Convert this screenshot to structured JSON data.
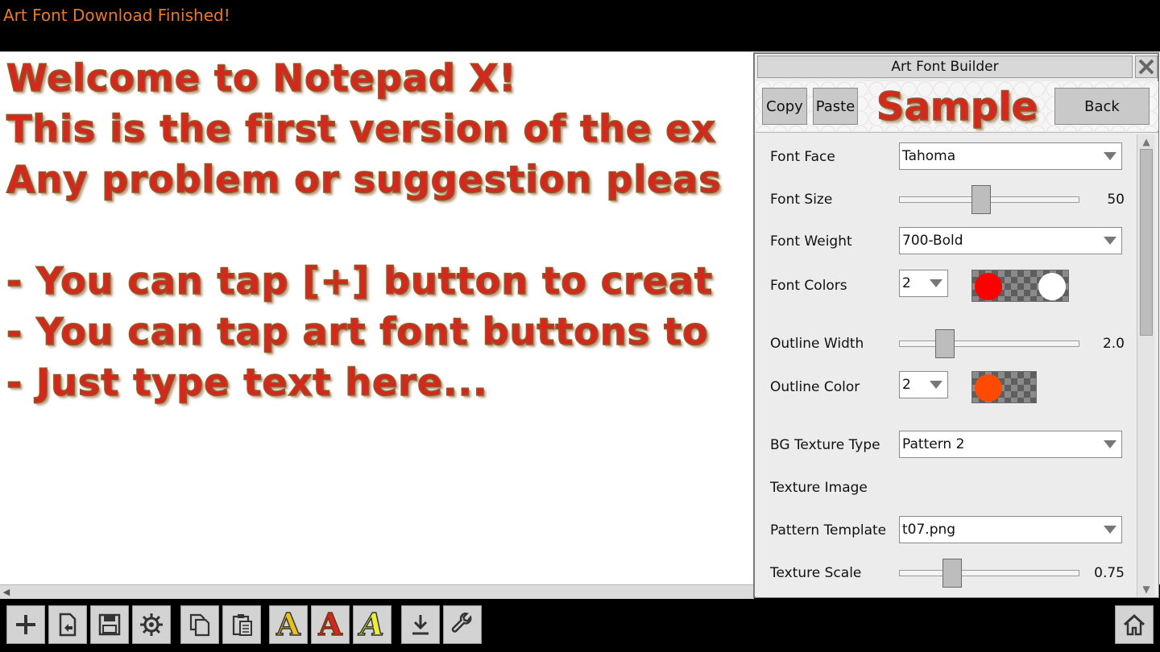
{
  "status": {
    "message": "Art Font Download Finished!"
  },
  "editor": {
    "lines": [
      "Welcome to Notepad X!",
      "This is the first version of the ex",
      "Any problem or suggestion pleas",
      "",
      "- You can tap [+] button to creat",
      "- You can tap art font buttons to",
      "- Just type text here..."
    ]
  },
  "panel": {
    "title": "Art Font Builder",
    "copy_label": "Copy",
    "paste_label": "Paste",
    "sample_label": "Sample",
    "back_label": "Back",
    "font_face": {
      "label": "Font Face",
      "value": "Tahoma"
    },
    "font_size": {
      "label": "Font Size",
      "value": "50",
      "fraction": 0.45
    },
    "font_weight": {
      "label": "Font Weight",
      "value": "700-Bold"
    },
    "font_colors": {
      "label": "Font Colors",
      "count": "2",
      "colors": [
        "#ff0000",
        "#ffffff"
      ]
    },
    "outline_width": {
      "label": "Outline Width",
      "value": "2.0",
      "fraction": 0.22
    },
    "outline_color": {
      "label": "Outline Color",
      "count": "2",
      "colors": [
        "#ff4a00"
      ]
    },
    "bg_texture_type": {
      "label": "BG Texture Type",
      "value": "Pattern 2"
    },
    "texture_image": {
      "label": "Texture Image"
    },
    "pattern_template": {
      "label": "Pattern Template",
      "value": "t07.png"
    },
    "texture_scale": {
      "label": "Texture Scale",
      "value": "0.75",
      "fraction": 0.27
    }
  },
  "colors": {
    "status_text": "#e8792c",
    "art_font_red": "#d7261c",
    "toolbar_button": "#d3d3d3"
  },
  "toolbar": {
    "icons": [
      "plus-icon",
      "open-file-icon",
      "save-icon",
      "gear-icon",
      "copy-icon",
      "clipboard-icon",
      "art-font-a-yellow-icon",
      "art-font-a-red-icon",
      "art-font-a-italic-icon",
      "download-icon",
      "wrench-icon",
      "home-icon"
    ]
  }
}
